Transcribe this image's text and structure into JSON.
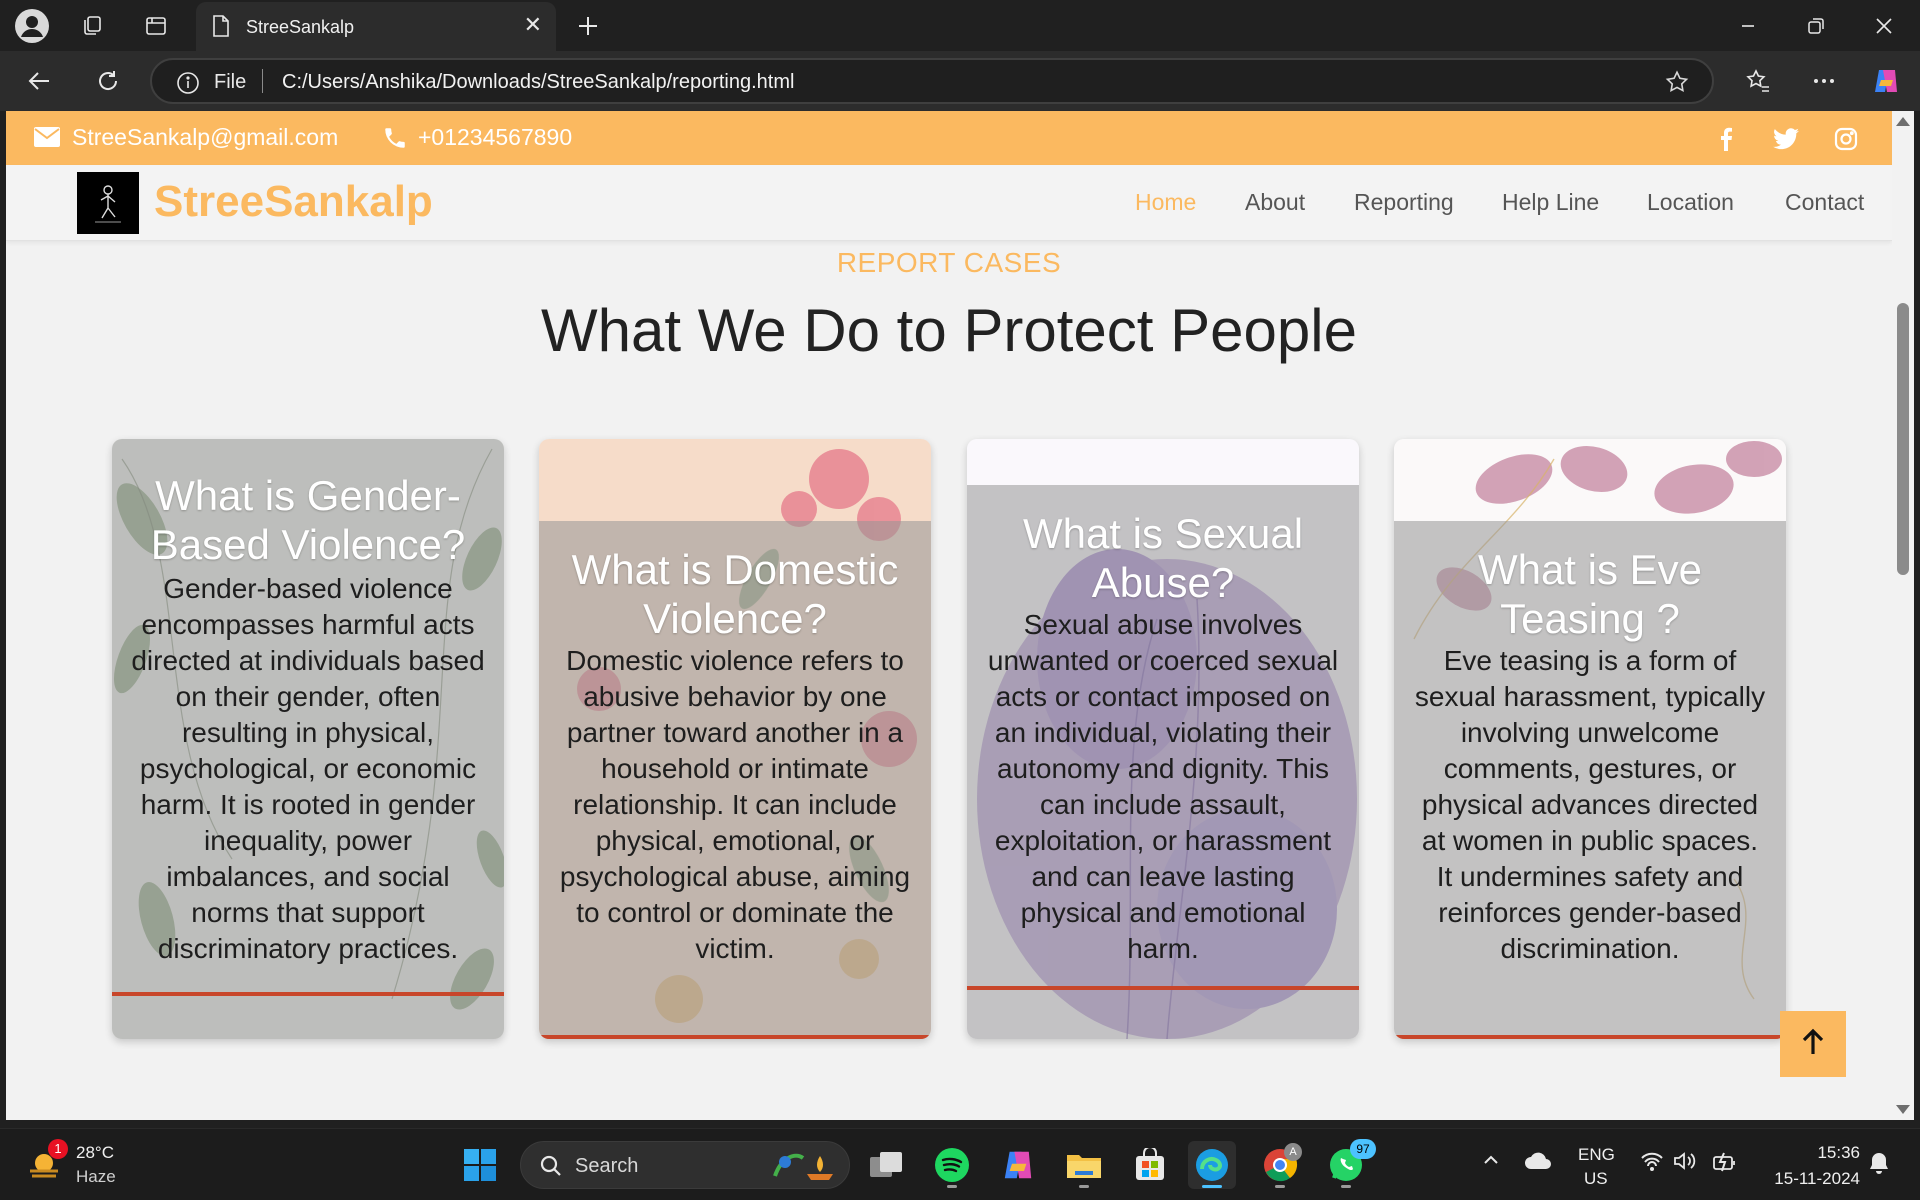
{
  "browser": {
    "tab_title": "StreeSankalp",
    "url_scheme": "File",
    "url": "C:/Users/Anshika/Downloads/StreeSankalp/reporting.html"
  },
  "topbar": {
    "email": "StreeSankalp@gmail.com",
    "phone": "+01234567890",
    "social_icons": [
      "facebook-icon",
      "twitter-icon",
      "instagram-icon"
    ]
  },
  "navbar": {
    "brand": "StreeSankalp",
    "links": [
      "Home",
      "About",
      "Reporting",
      "Help Line",
      "Location",
      "Contact"
    ],
    "active": "Home"
  },
  "section": {
    "eyebrow": "REPORT CASES",
    "title": "What We Do to Protect People"
  },
  "cards": [
    {
      "title": "What is Gender-Based Violence?",
      "body": "Gender-based violence encompasses harmful acts directed at individuals based on their gender, often resulting in physical, psychological, or economic harm. It is rooted in gender inequality, power imbalances, and social norms that support discriminatory practices."
    },
    {
      "title": "What is Domestic Violence?",
      "body": "Domestic violence refers to abusive behavior by one partner toward another in a household or intimate relationship. It can include physical, emotional, or psychological abuse, aiming to control or dominate the victim."
    },
    {
      "title": "What is Sexual Abuse?",
      "body": "Sexual abuse involves unwanted or coerced sexual acts or contact imposed on an individual, violating their autonomy and dignity. This can include assault, exploitation, or harassment and can leave lasting physical and emotional harm."
    },
    {
      "title": "What is Eve Teasing ?",
      "body": "Eve teasing is a form of sexual harassment, typically involving unwelcome comments, gestures, or physical advances directed at women in public spaces. It undermines safety and reinforces gender-based discrimination."
    }
  ],
  "taskbar": {
    "weather_badge": "1",
    "temperature": "28°C",
    "condition": "Haze",
    "search_placeholder": "Search",
    "whatsapp_badge": "97",
    "chrome_badge": "A",
    "lang_line1": "ENG",
    "lang_line2": "US",
    "time": "15:36",
    "date": "15-11-2024"
  },
  "colors": {
    "accent": "#fbb960",
    "card_stripe": "#c8462a",
    "taskbar_active": "#4cc2ff"
  }
}
